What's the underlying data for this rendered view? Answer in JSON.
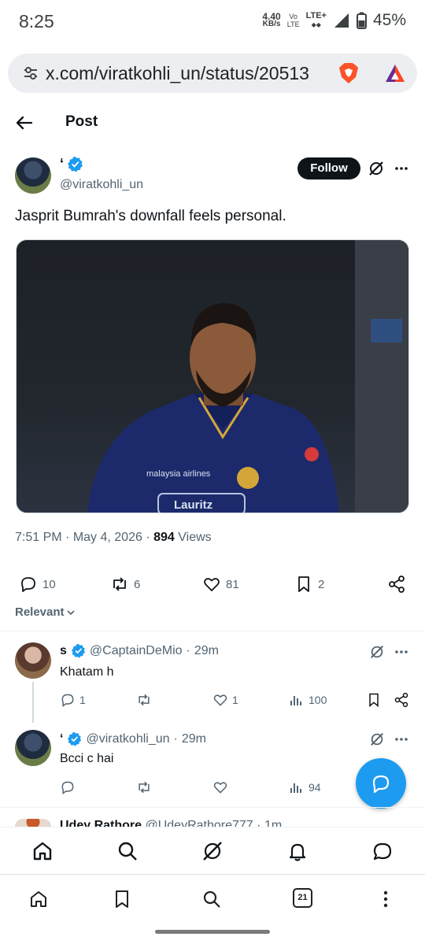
{
  "status_bar": {
    "time": "8:25",
    "speed_value": "4.40",
    "speed_unit": "KB/s",
    "volte_line1": "Vo",
    "volte_line2": "LTE",
    "lte": "LTE+",
    "battery": "45%"
  },
  "browser": {
    "url": "x.com/viratkohli_un/status/20513"
  },
  "header": {
    "title": "Post"
  },
  "post": {
    "author_name": "‘",
    "author_handle": "@viratkohli_un",
    "follow_label": "Follow",
    "text": "Jasprit Bumrah's downfall feels personal.",
    "time": "7:51 PM",
    "date": "May 4, 2026",
    "views_count": "894",
    "views_label": "Views",
    "replies": "10",
    "reposts": "6",
    "likes": "81",
    "bookmarks": "2",
    "media_jersey_text": "Lauritz",
    "media_sponsor_text": "malaysia airlines"
  },
  "sort": {
    "label": "Relevant"
  },
  "replies": [
    {
      "name": "s",
      "handle": "@CaptainDeMio",
      "time": "29m",
      "text": "Khatam h",
      "replies": "1",
      "reposts": "",
      "likes": "1",
      "views": "100"
    },
    {
      "name": "‘",
      "handle": "@viratkohli_un",
      "time": "29m",
      "text": "Bcci c hai",
      "replies": "",
      "reposts": "",
      "likes": "",
      "views": "94"
    },
    {
      "name": "Udey Rathore",
      "handle": "@UdeyRathore777",
      "time": "1m"
    }
  ],
  "browser_nav": {
    "tab_count": "21"
  },
  "colors": {
    "accent": "#1d9bf0",
    "text": "#0f1419",
    "secondary": "#536471"
  }
}
